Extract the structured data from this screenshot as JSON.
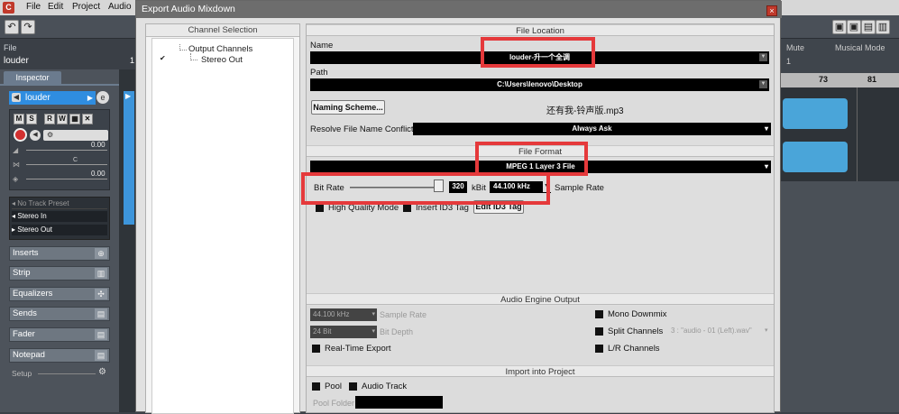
{
  "menubar": {
    "items": [
      "File",
      "Edit",
      "Project",
      "Audio"
    ]
  },
  "daw": {
    "file_label": "File",
    "track_value": "louder",
    "inspector_tab": "Inspector",
    "track_name": "louder",
    "level_1": "0.00",
    "level_2": "0.00",
    "pan_c": "C",
    "no_track_preset": "No Track Preset",
    "stereo_in": "Stereo In",
    "stereo_out": "Stereo Out",
    "sections": [
      "Inserts",
      "Strip",
      "Equalizers",
      "Sends",
      "Fader",
      "Notepad"
    ],
    "setup": "Setup",
    "mute_label": "Mute",
    "musical_mode": "Musical Mode",
    "ruler_73": "73",
    "ruler_81": "81",
    "mute_1": "1"
  },
  "dialog": {
    "title": "Export Audio Mixdown",
    "close_symbol": "×",
    "channel_selection": {
      "header": "Channel Selection",
      "root": "Output Channels",
      "child": "Stereo Out",
      "checkmark": "✔"
    },
    "file_location": {
      "header": "File Location",
      "name_label": "Name",
      "name_value": "louder-升一个全调",
      "path_label": "Path",
      "path_value": "C:\\Users\\lenovo\\Desktop",
      "naming_button": "Naming Scheme...",
      "naming_preview": "还有我-铃声版.mp3",
      "resolve_label": "Resolve File Name Conflicts",
      "resolve_value": "Always Ask"
    },
    "file_format": {
      "header": "File Format",
      "format_value": "MPEG 1 Layer 3 File",
      "bitrate_label": "Bit Rate",
      "bitrate_value": "320",
      "bitrate_unit": "kBit",
      "samplerate_value": "44.100 kHz",
      "samplerate_label": "Sample Rate",
      "high_quality": "High Quality Mode",
      "insert_id3": "Insert ID3 Tag",
      "edit_id3": "Edit ID3 Tag"
    },
    "engine_output": {
      "header": "Audio Engine Output",
      "sample_rate_value": "44.100 kHz",
      "sample_rate_label": "Sample Rate",
      "bit_depth_value": "24 Bit",
      "bit_depth_label": "Bit Depth",
      "realtime": "Real-Time Export",
      "mono_downmix": "Mono Downmix",
      "split_channels": "Split Channels",
      "split_value": "3 : \"audio - 01 (Left).wav\"",
      "lr_channels": "L/R Channels"
    },
    "import_project": {
      "header": "Import into Project",
      "pool": "Pool",
      "audio_track": "Audio Track",
      "pool_folder": "Pool Folder"
    }
  },
  "colors": {
    "highlight_box": "#e5393b",
    "track_blue": "#2f8de0",
    "wave_blue": "#4aa5d9"
  }
}
